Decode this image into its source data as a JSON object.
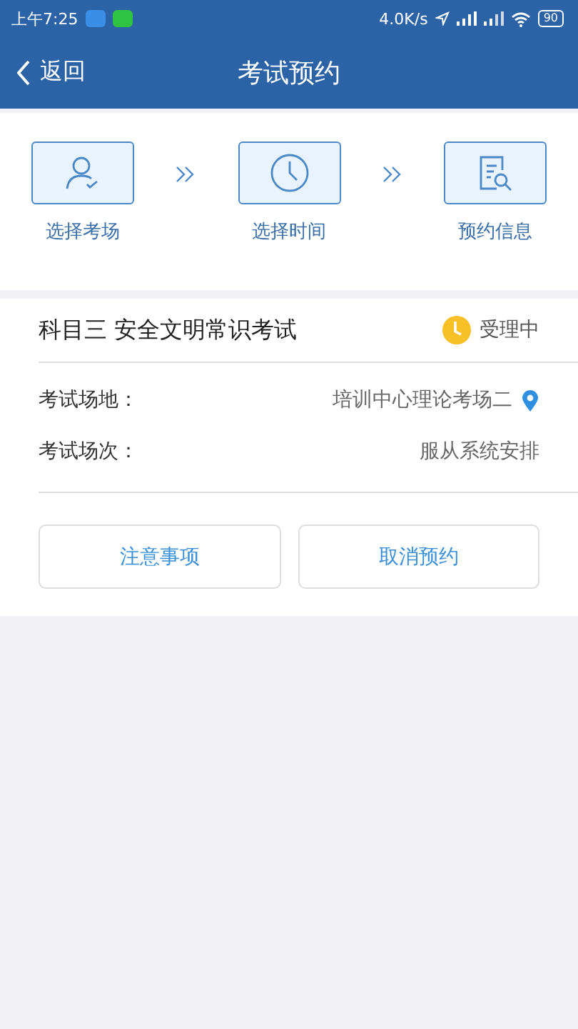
{
  "status_bar": {
    "time": "上午7:25",
    "speed": "4.0K/s",
    "battery": "90"
  },
  "header": {
    "back": "返回",
    "title": "考试预约"
  },
  "steps": [
    {
      "kind": "person",
      "label": "选择考场"
    },
    {
      "kind": "clock",
      "label": "选择时间"
    },
    {
      "kind": "document",
      "label": "预约信息"
    }
  ],
  "exam": {
    "title": "科目三 安全文明常识考试",
    "status": "受理中",
    "fields": [
      {
        "label": "考试场地：",
        "value": "培训中心理论考场二",
        "kind": "location"
      },
      {
        "label": "考试场次：",
        "value": "服从系统安排",
        "kind": "plain"
      }
    ]
  },
  "buttons": [
    "注意事项",
    "取消预约"
  ]
}
